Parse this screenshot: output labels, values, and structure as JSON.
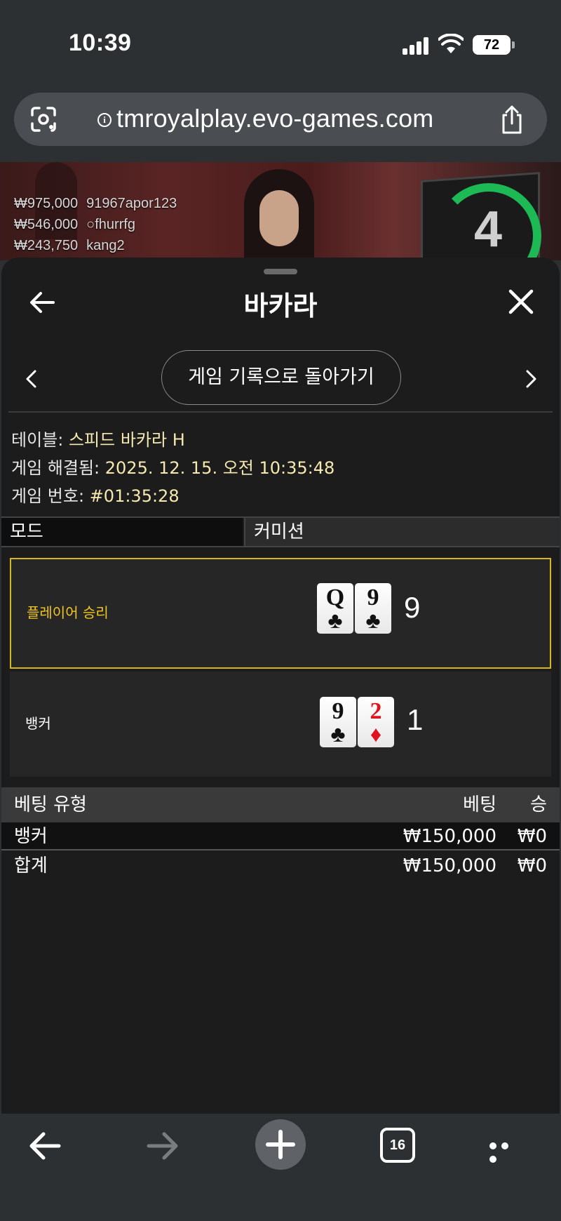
{
  "status_bar": {
    "time": "10:39",
    "battery": "72"
  },
  "browser": {
    "url": "tmroyalplay.evo-games.com",
    "tab_count": "16"
  },
  "stream": {
    "timer": "4",
    "winners": [
      {
        "amount": "₩975,000",
        "name": "91967apor123"
      },
      {
        "amount": "₩546,000",
        "name": "○fhurrfg"
      },
      {
        "amount": "₩243,750",
        "name": "kang2"
      }
    ]
  },
  "sheet": {
    "title": "바카라",
    "history_button": "게임 기록으로 돌아가기",
    "info": {
      "table_label": "테이블:",
      "table_value": "스피드 바카라 H",
      "resolved_label": "게임 해결됨:",
      "resolved_value": "2025. 12. 15. 오전 10:35:48",
      "game_no_label": "게임 번호:",
      "game_no_value": "#01:35:28"
    },
    "mode_label": "모드",
    "commission_label": "커미션",
    "player": {
      "label": "플레이어 승리",
      "cards": [
        {
          "rank": "Q",
          "suit": "♣",
          "color": "black"
        },
        {
          "rank": "9",
          "suit": "♣",
          "color": "black"
        }
      ],
      "score": "9"
    },
    "banker": {
      "label": "뱅커",
      "cards": [
        {
          "rank": "9",
          "suit": "♣",
          "color": "black"
        },
        {
          "rank": "2",
          "suit": "♦",
          "color": "red"
        }
      ],
      "score": "1"
    },
    "bets": {
      "headers": {
        "type": "베팅 유형",
        "bet": "베팅",
        "win": "승"
      },
      "rows": [
        {
          "type": "뱅커",
          "bet": "₩150,000",
          "win": "₩0"
        }
      ],
      "total": {
        "type": "합계",
        "bet": "₩150,000",
        "win": "₩0"
      }
    }
  },
  "colors": {
    "accent_yellow": "#d9b51c",
    "player_label": "#f0c61c",
    "info_value": "#f5e9b0",
    "timer_green": "#1db954"
  }
}
